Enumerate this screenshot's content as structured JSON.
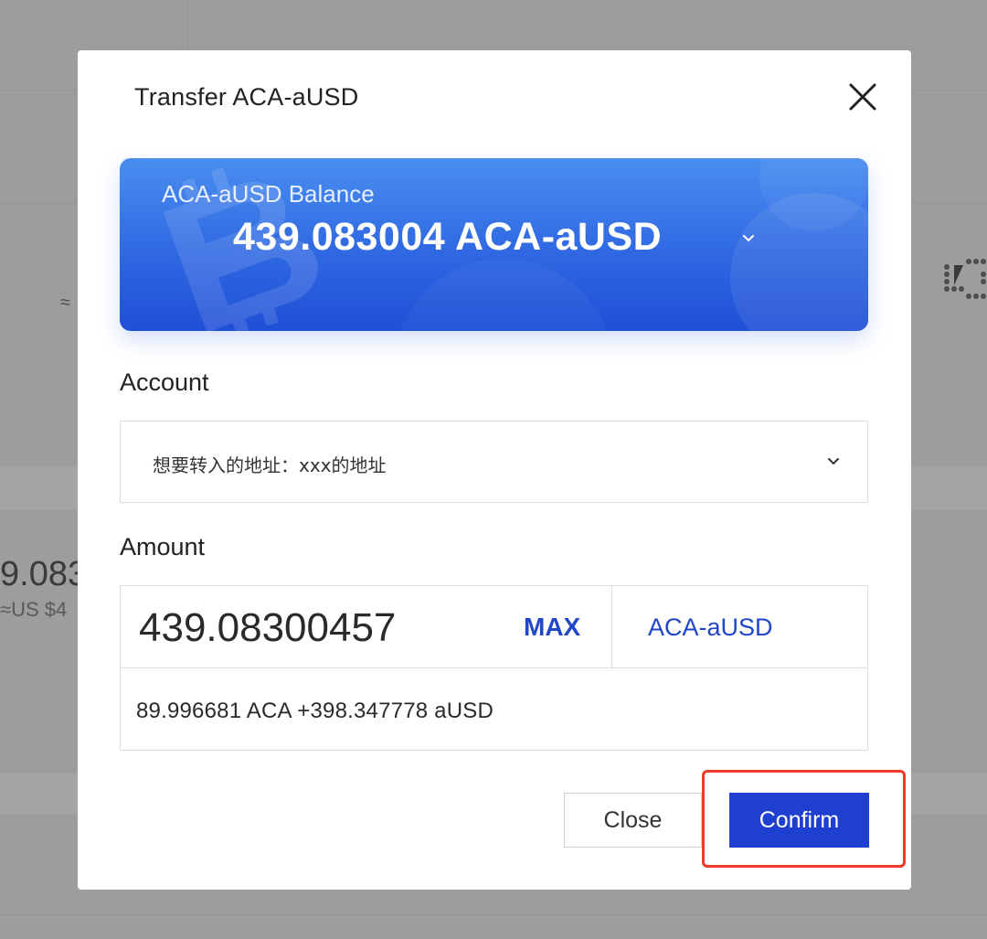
{
  "background": {
    "approx_symbol": "≈",
    "value_fragment": "9.083",
    "usd_fragment": "≈US $4"
  },
  "modal": {
    "title": "Transfer  ACA-aUSD",
    "close_icon": "close-icon",
    "balance_card": {
      "label": "ACA-aUSD Balance",
      "value": "439.083004 ACA-aUSD",
      "chevron_icon": "chevron-down-icon",
      "decor_icon": "bitcoin-icon"
    },
    "account": {
      "label": "Account",
      "selected": "想要转入的地址：xxx的地址",
      "chevron_icon": "chevron-down-icon"
    },
    "amount": {
      "label": "Amount",
      "value": "439.08300457",
      "max_label": "MAX",
      "token": "ACA-aUSD",
      "breakdown": "89.996681 ACA +398.347778 aUSD"
    },
    "buttons": {
      "close": "Close",
      "confirm": "Confirm"
    }
  },
  "colors": {
    "accent": "#1f3fd0",
    "link": "#1f47c8",
    "card_top": "#4a8ef0",
    "card_bottom": "#1f4fd6",
    "highlight": "#ec3b2a"
  }
}
